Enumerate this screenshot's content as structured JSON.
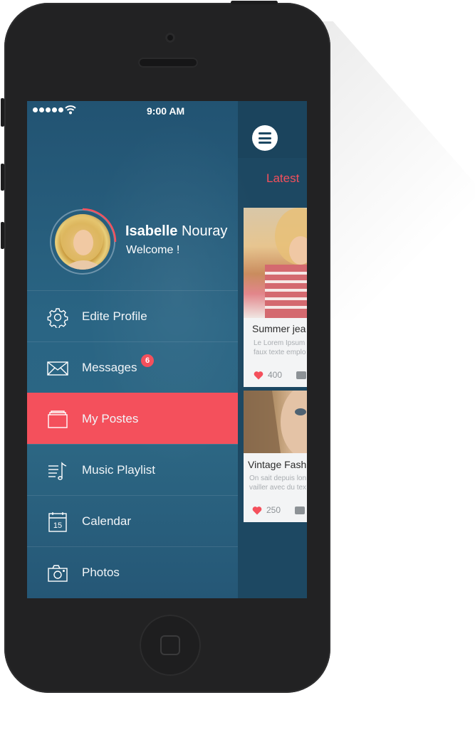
{
  "status_bar": {
    "time": "9:00 AM",
    "signal_dots": 5
  },
  "profile": {
    "first_name": "Isabelle",
    "last_name": "Nouray",
    "greeting": "Welcome !"
  },
  "menu": {
    "items": [
      {
        "label": "Edite Profile",
        "icon": "gear-icon"
      },
      {
        "label": "Messages",
        "icon": "envelope-icon",
        "badge": "6"
      },
      {
        "label": "My Postes",
        "icon": "folder-icon",
        "active": true
      },
      {
        "label": "Music Playlist",
        "icon": "music-list-icon"
      },
      {
        "label": "Calendar",
        "icon": "calendar-icon",
        "date": "15"
      },
      {
        "label": "Photos",
        "icon": "camera-icon"
      }
    ]
  },
  "feed": {
    "tab": "Latest",
    "cards": [
      {
        "title": "Summer jea",
        "desc_lines": [
          "Le Lorem Ipsum",
          "faux texte emplo"
        ],
        "likes": "400"
      },
      {
        "title": "Vintage Fash",
        "desc_lines": [
          "On sait depuis lon",
          "vailler avec du tex"
        ],
        "likes": "250"
      }
    ]
  },
  "colors": {
    "accent": "#f4505c",
    "menu_bg": "#2a6584",
    "phone": "#222223"
  }
}
